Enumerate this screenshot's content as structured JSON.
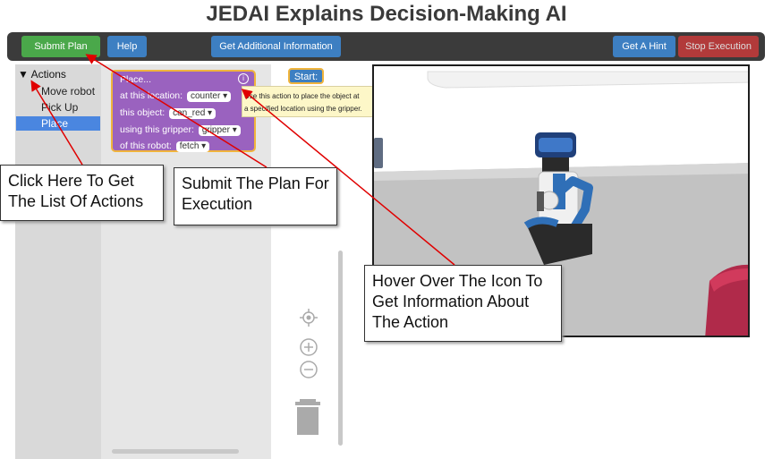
{
  "title": "JEDAI Explains Decision-Making AI",
  "toolbar": {
    "submit_plan": "Submit Plan",
    "help": "Help",
    "additional_info": "Get Additional Information",
    "hint": "Get A Hint",
    "stop": "Stop Execution"
  },
  "colors": {
    "submit": "#4aa84a",
    "blue": "#3d7fc2",
    "stop": "#b23a3a",
    "block": "#9a62bf",
    "outline": "#f0b43c",
    "arrow": "#e00000"
  },
  "tree": {
    "root": "Actions",
    "items": [
      "Move robot",
      "Pick Up",
      "Place"
    ],
    "selected": "Place"
  },
  "block": {
    "header": "Place...",
    "row1_label": "at this location:",
    "row1_value": "counter",
    "row2_label": "this object:",
    "row2_value": "can_red",
    "row3_label": "using this gripper:",
    "row3_value": "gripper",
    "row4_label": "of this robot:",
    "row4_value": "fetch",
    "dropdown_glyph": "▾"
  },
  "tooltip": {
    "line1": "Use this action to place the object at",
    "line2": "a specified location using the gripper."
  },
  "workspace": {
    "start": "Start:"
  },
  "callouts": {
    "actions_list": "Click Here To Get The List Of Actions",
    "submit": "Submit The Plan For Execution",
    "hover_icon": "Hover Over The Icon To Get Information About The Action"
  }
}
